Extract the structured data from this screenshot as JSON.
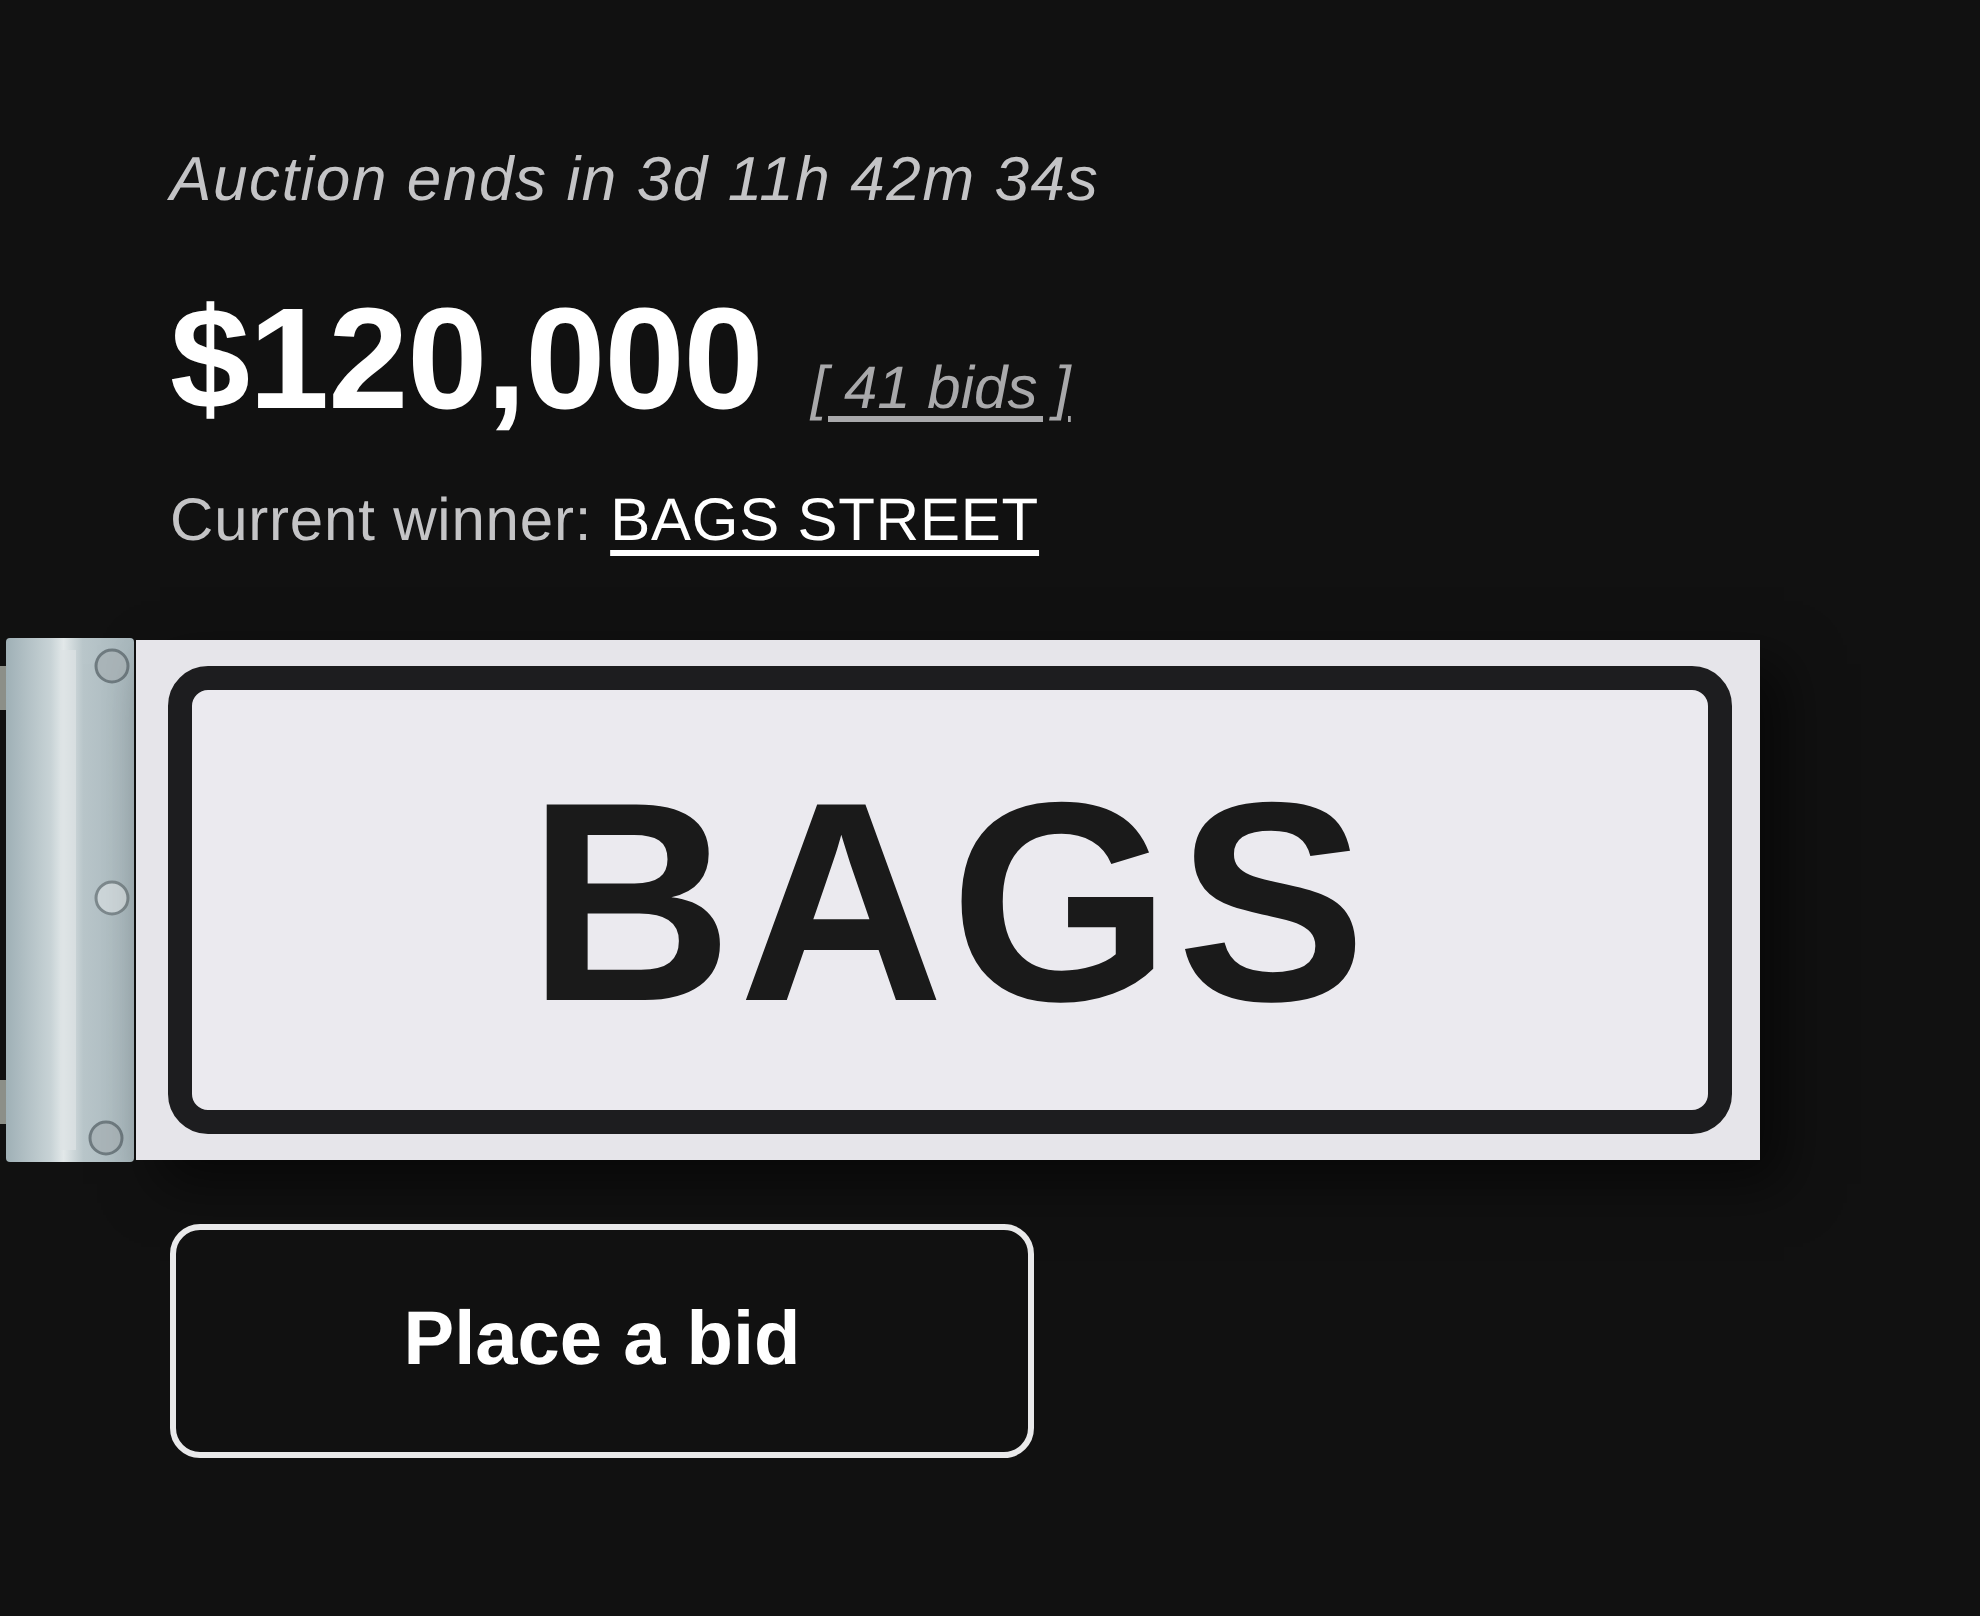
{
  "auction": {
    "countdown": "Auction ends in 3d 11h 42m 34s",
    "price": "$120,000",
    "bids": "[ 41 bids ]",
    "winner_label": "Current winner:",
    "winner": "BAGS STREET"
  },
  "sign": {
    "text": "BAGS"
  },
  "button": {
    "label": "Place a bid"
  }
}
